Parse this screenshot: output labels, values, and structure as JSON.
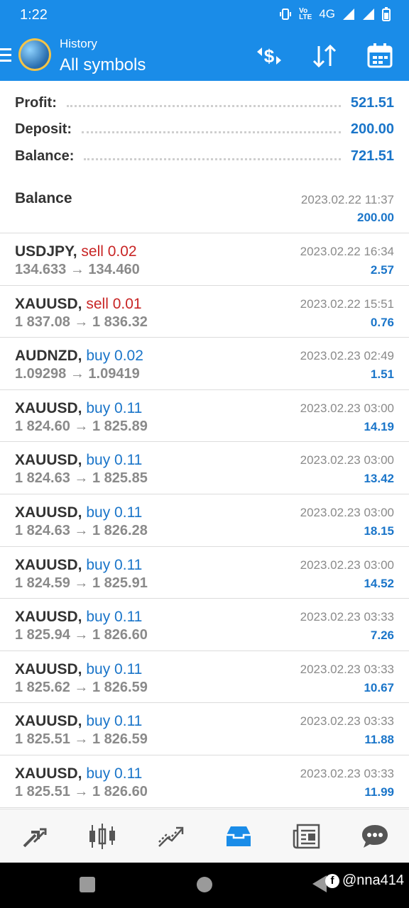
{
  "status": {
    "time": "1:22",
    "network": "4G"
  },
  "header": {
    "subtitle": "History",
    "title": "All symbols"
  },
  "summary": {
    "profit_label": "Profit:",
    "profit_value": "521.51",
    "deposit_label": "Deposit:",
    "deposit_value": "200.00",
    "balance_label": "Balance:",
    "balance_value": "721.51"
  },
  "balance_entry": {
    "label": "Balance",
    "date": "2023.02.22 11:37",
    "amount": "200.00"
  },
  "trades": [
    {
      "symbol": "USDJPY,",
      "side": "sell 0.02",
      "type": "sell",
      "prices": "134.633 → 134.460",
      "date": "2023.02.22 16:34",
      "profit": "2.57"
    },
    {
      "symbol": "XAUUSD,",
      "side": "sell 0.01",
      "type": "sell",
      "prices": "1 837.08 → 1 836.32",
      "date": "2023.02.22 15:51",
      "profit": "0.76"
    },
    {
      "symbol": "AUDNZD,",
      "side": "buy 0.02",
      "type": "buy",
      "prices": "1.09298 → 1.09419",
      "date": "2023.02.23 02:49",
      "profit": "1.51"
    },
    {
      "symbol": "XAUUSD,",
      "side": "buy 0.11",
      "type": "buy",
      "prices": "1 824.60 → 1 825.89",
      "date": "2023.02.23 03:00",
      "profit": "14.19"
    },
    {
      "symbol": "XAUUSD,",
      "side": "buy 0.11",
      "type": "buy",
      "prices": "1 824.63 → 1 825.85",
      "date": "2023.02.23 03:00",
      "profit": "13.42"
    },
    {
      "symbol": "XAUUSD,",
      "side": "buy 0.11",
      "type": "buy",
      "prices": "1 824.63 → 1 826.28",
      "date": "2023.02.23 03:00",
      "profit": "18.15"
    },
    {
      "symbol": "XAUUSD,",
      "side": "buy 0.11",
      "type": "buy",
      "prices": "1 824.59 → 1 825.91",
      "date": "2023.02.23 03:00",
      "profit": "14.52"
    },
    {
      "symbol": "XAUUSD,",
      "side": "buy 0.11",
      "type": "buy",
      "prices": "1 825.94 → 1 826.60",
      "date": "2023.02.23 03:33",
      "profit": "7.26"
    },
    {
      "symbol": "XAUUSD,",
      "side": "buy 0.11",
      "type": "buy",
      "prices": "1 825.62 → 1 826.59",
      "date": "2023.02.23 03:33",
      "profit": "10.67"
    },
    {
      "symbol": "XAUUSD,",
      "side": "buy 0.11",
      "type": "buy",
      "prices": "1 825.51 → 1 826.59",
      "date": "2023.02.23 03:33",
      "profit": "11.88"
    },
    {
      "symbol": "XAUUSD,",
      "side": "buy 0.11",
      "type": "buy",
      "prices": "1 825.51 → 1 826.60",
      "date": "2023.02.23 03:33",
      "profit": "11.99"
    }
  ],
  "bottom_nav": [
    "quotes-icon",
    "chart-icon",
    "trade-icon",
    "history-icon",
    "news-icon",
    "messages-icon"
  ],
  "watermark": "@nna414",
  "colors": {
    "accent": "#1a8ce8",
    "buy": "#1a75c9",
    "sell": "#c82525",
    "active_nav": "#1a8ce8"
  }
}
